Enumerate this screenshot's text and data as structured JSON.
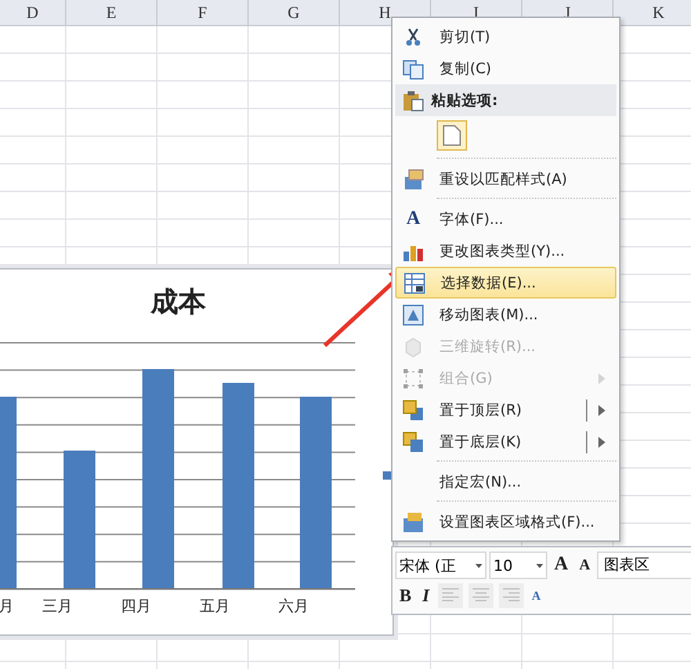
{
  "columns": [
    "D",
    "E",
    "F",
    "G",
    "H",
    "I",
    "J",
    "K"
  ],
  "chart": {
    "title": "成本",
    "categories": [
      "月",
      "三月",
      "四月",
      "五月",
      "六月"
    ]
  },
  "menu": [
    {
      "kind": "item",
      "label": "剪切(T)",
      "disabled": false,
      "selected": false,
      "submenu": false,
      "split": false
    },
    {
      "kind": "item",
      "label": "复制(C)",
      "disabled": false,
      "selected": false,
      "submenu": false,
      "split": false
    },
    {
      "kind": "header",
      "label": "粘贴选项:"
    },
    {
      "kind": "paste"
    },
    {
      "kind": "separator"
    },
    {
      "kind": "item",
      "label": "重设以匹配样式(A)",
      "disabled": false,
      "selected": false,
      "submenu": false,
      "split": false
    },
    {
      "kind": "separator"
    },
    {
      "kind": "item",
      "label": "字体(F)...",
      "glyph": "A",
      "disabled": false,
      "selected": false,
      "submenu": false,
      "split": false
    },
    {
      "kind": "item",
      "label": "更改图表类型(Y)...",
      "disabled": false,
      "selected": false,
      "submenu": false,
      "split": false
    },
    {
      "kind": "item",
      "label": "选择数据(E)...",
      "disabled": false,
      "selected": true,
      "submenu": false,
      "split": false
    },
    {
      "kind": "item",
      "label": "移动图表(M)...",
      "disabled": false,
      "selected": false,
      "submenu": false,
      "split": false
    },
    {
      "kind": "item",
      "label": "三维旋转(R)...",
      "disabled": true,
      "selected": false,
      "submenu": false,
      "split": false
    },
    {
      "kind": "item",
      "label": "组合(G)",
      "disabled": true,
      "selected": false,
      "submenu": true,
      "split": false
    },
    {
      "kind": "item",
      "label": "置于顶层(R)",
      "disabled": false,
      "selected": false,
      "submenu": true,
      "split": true
    },
    {
      "kind": "item",
      "label": "置于底层(K)",
      "disabled": false,
      "selected": false,
      "submenu": true,
      "split": true
    },
    {
      "kind": "separator"
    },
    {
      "kind": "item",
      "label": "指定宏(N)...",
      "disabled": false,
      "selected": false,
      "submenu": false,
      "split": false
    },
    {
      "kind": "separator"
    },
    {
      "kind": "item",
      "label": "设置图表区域格式(F)...",
      "disabled": false,
      "selected": false,
      "submenu": false,
      "split": false
    }
  ],
  "toolbar": {
    "font": "宋体 (正",
    "size": "10",
    "grow_font": "A",
    "shrink_font": "A",
    "element": "图表区",
    "buttons": [
      {
        "kind": "bold",
        "label": "B",
        "disabled": false
      },
      {
        "kind": "italic",
        "label": "I",
        "disabled": false
      },
      {
        "kind": "align-left",
        "disabled": true
      },
      {
        "kind": "align-center",
        "disabled": true
      },
      {
        "kind": "align-right",
        "disabled": true
      },
      {
        "kind": "font-color",
        "label": "A",
        "disabled": false
      }
    ]
  }
}
